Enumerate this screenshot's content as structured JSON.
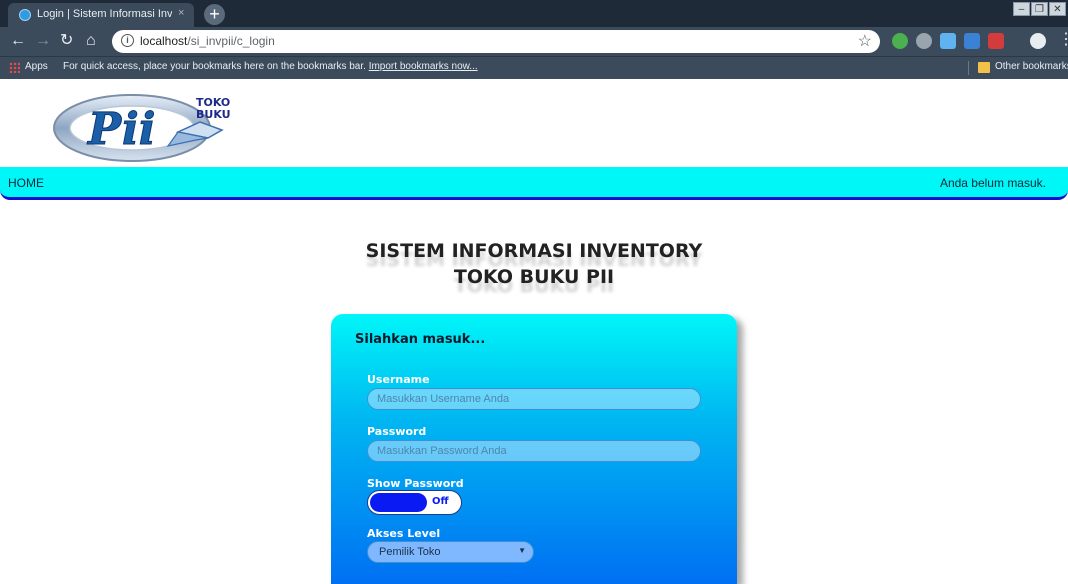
{
  "browser": {
    "tab_title": "Login | Sistem Informasi Inventory",
    "tab_close": "×",
    "new_tab": "+",
    "url_host": "localhost",
    "url_path": "/si_invpii/c_login",
    "bookmarks_apps": "Apps",
    "bookmarks_hint": "For quick access, place your bookmarks here on the bookmarks bar.",
    "bookmarks_import": "Import bookmarks now...",
    "other_bookmarks": "Other bookmarks"
  },
  "logo": {
    "text": "TOKO BUKU",
    "letters": "PII"
  },
  "nav": {
    "home": "HOME",
    "status": "Anda belum masuk."
  },
  "heading": {
    "line1": "SISTEM INFORMASI INVENTORY",
    "line2": "TOKO BUKU PII"
  },
  "login": {
    "title": "Silahkan masuk...",
    "username_label": "Username",
    "username_placeholder": "Masukkan Username Anda",
    "password_label": "Password",
    "password_placeholder": "Masukkan Password Anda",
    "show_password_label": "Show Password",
    "toggle_state": "Off",
    "akses_label": "Akses Level",
    "akses_value": "Pemilik Toko"
  },
  "colors": {
    "navbar": "#00f7f7",
    "accent": "#1010d0",
    "card_top": "#00f6f8",
    "card_bottom": "#0070f2"
  }
}
